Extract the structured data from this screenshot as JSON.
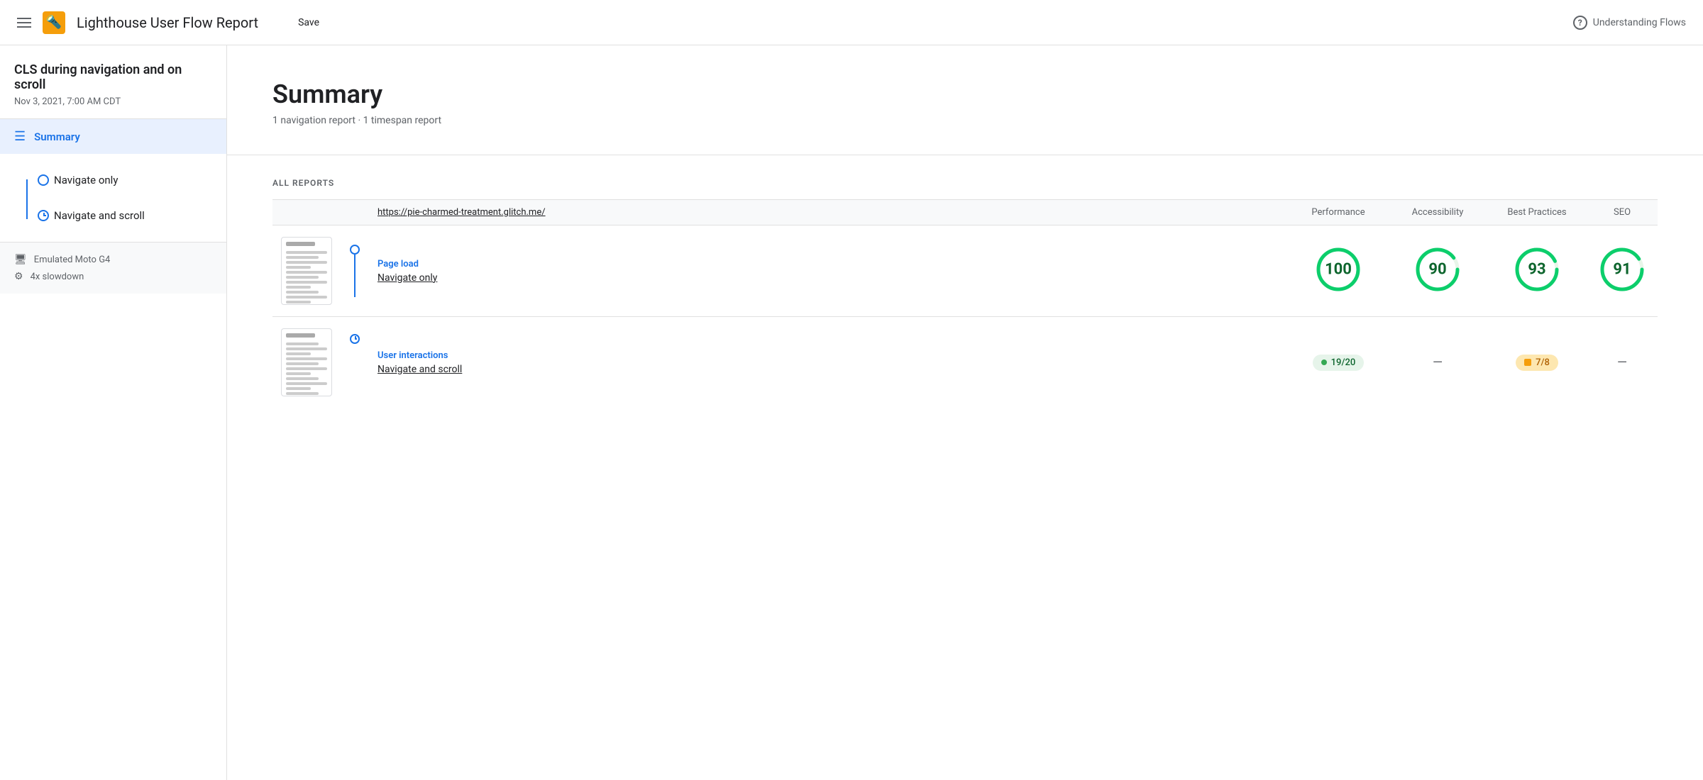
{
  "header": {
    "menu_icon": "hamburger",
    "logo_icon": "🔦",
    "title": "Lighthouse User Flow Report",
    "save_label": "Save",
    "help_icon": "?",
    "understanding_flows_label": "Understanding Flows"
  },
  "sidebar": {
    "project_title": "CLS during navigation and on scroll",
    "project_date": "Nov 3, 2021, 7:00 AM CDT",
    "summary_label": "Summary",
    "nav_items": [
      {
        "label": "Navigate only",
        "type": "dot"
      },
      {
        "label": "Navigate and scroll",
        "type": "clock"
      }
    ],
    "meta": [
      {
        "icon": "monitor",
        "label": "Emulated Moto G4"
      },
      {
        "icon": "cpu",
        "label": "4x slowdown"
      }
    ]
  },
  "summary": {
    "title": "Summary",
    "subtitle": "1 navigation report · 1 timespan report"
  },
  "reports": {
    "section_label": "ALL REPORTS",
    "table_headers": {
      "url": "https://pie-charmed-treatment.glitch.me/",
      "performance": "Performance",
      "accessibility": "Accessibility",
      "best_practices": "Best Practices",
      "seo": "SEO"
    },
    "rows": [
      {
        "type_label": "Page load",
        "name": "Navigate only",
        "flow_type": "dot",
        "performance": {
          "score": 100,
          "type": "circle",
          "color_green": true
        },
        "accessibility": {
          "score": 90,
          "type": "circle",
          "color_green": true
        },
        "best_practices": {
          "score": 93,
          "type": "circle",
          "color_green": true
        },
        "seo": {
          "score": 91,
          "type": "circle",
          "color_green": true
        }
      },
      {
        "type_label": "User interactions",
        "name": "Navigate and scroll",
        "flow_type": "clock",
        "performance": {
          "score": "19/20",
          "type": "pill_green"
        },
        "accessibility": {
          "score": "—",
          "type": "dash"
        },
        "best_practices": {
          "score": "7/8",
          "type": "pill_orange"
        },
        "seo": {
          "score": "—",
          "type": "dash"
        }
      }
    ]
  }
}
